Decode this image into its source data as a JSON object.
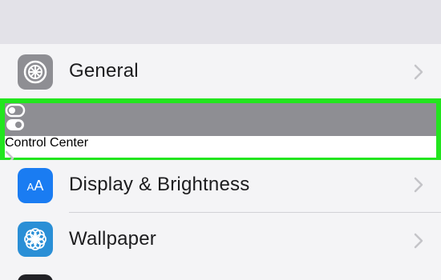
{
  "settings": {
    "items": [
      {
        "label": "General",
        "icon": "gear-icon",
        "icon_bg": "#8e8e93"
      },
      {
        "label": "Control Center",
        "icon": "toggle-switches-icon",
        "icon_bg": "#8e8e93",
        "highlighted": true
      },
      {
        "label": "Display & Brightness",
        "icon": "text-size-icon",
        "icon_text": "AA",
        "icon_bg": "#1a7cf2"
      },
      {
        "label": "Wallpaper",
        "icon": "flower-icon",
        "icon_bg": "#2a8fd6"
      }
    ]
  },
  "colors": {
    "highlight_border": "#22e51e",
    "chevron": "#c4c4c8",
    "label": "#1c1c1e",
    "list_background": "#f4f4f6"
  }
}
